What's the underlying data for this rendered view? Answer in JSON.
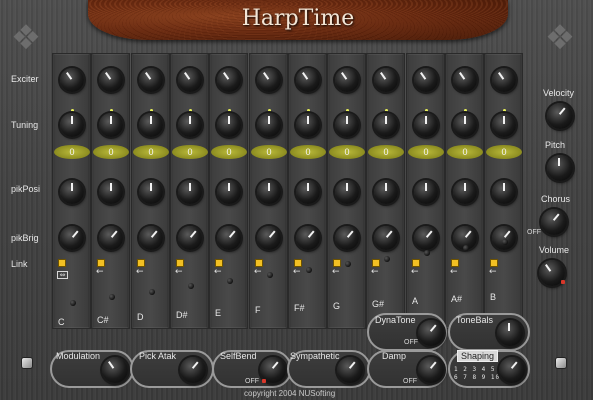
{
  "app": {
    "title": "HarpTime",
    "copyright": "copyright 2004 NUSofting"
  },
  "rows": {
    "exciter": "Exciter",
    "tuning": "Tuning",
    "pikposi": "pikPosi",
    "pikbrig": "pikBrig",
    "link": "Link"
  },
  "strings": [
    {
      "note": "C",
      "tuning_value": "0",
      "link": "both"
    },
    {
      "note": "C#",
      "tuning_value": "0",
      "link": "left"
    },
    {
      "note": "D",
      "tuning_value": "0",
      "link": "left"
    },
    {
      "note": "D#",
      "tuning_value": "0",
      "link": "left"
    },
    {
      "note": "E",
      "tuning_value": "0",
      "link": "left"
    },
    {
      "note": "F",
      "tuning_value": "0",
      "link": "left"
    },
    {
      "note": "F#",
      "tuning_value": "0",
      "link": "left"
    },
    {
      "note": "G",
      "tuning_value": "0",
      "link": "left"
    },
    {
      "note": "G#",
      "tuning_value": "0",
      "link": "left"
    },
    {
      "note": "A",
      "tuning_value": "0",
      "link": "left"
    },
    {
      "note": "A#",
      "tuning_value": "0",
      "link": "left"
    },
    {
      "note": "B",
      "tuning_value": "0",
      "link": "left"
    }
  ],
  "right_panel": {
    "velocity": "Velocity",
    "pitch": "Pitch",
    "chorus": "Chorus",
    "chorus_off": "OFF",
    "volume": "Volume"
  },
  "bottom": {
    "modulation": "Modulation",
    "pick_atak": "Pick Atak",
    "selfbend": "SelfBend",
    "selfbend_off": "OFF",
    "sympathetic": "Sympathetic",
    "dynatone": "DynaTone",
    "dynatone_off": "OFF",
    "tonebals": "ToneBals",
    "damp": "Damp",
    "damp_off": "OFF",
    "shaping": "Shaping",
    "shaping_options": "1 2 3 4 5",
    "shaping_options2": "6 7 8 9 10"
  },
  "colors": {
    "wood": "#6c2a10",
    "panel": "#444444",
    "value_pill": "#9a9a28",
    "link_on": "#f2c023",
    "accent_red": "#d8372a"
  },
  "icons": {
    "corner_left": "celtic-knot-icon",
    "corner_right": "celtic-knot-icon",
    "link_left": "arrow-left-icon",
    "link_both": "link-both-icon"
  }
}
